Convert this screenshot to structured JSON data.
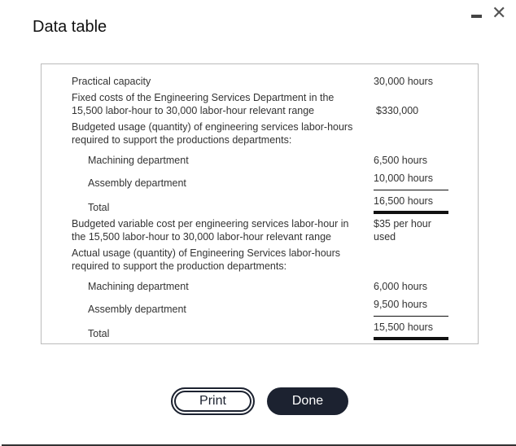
{
  "dialog": {
    "title": "Data table",
    "minimize_icon": "minimize-icon",
    "close_icon": "close-icon",
    "close_glyph": "✕"
  },
  "table": {
    "practical_capacity": {
      "label": "Practical capacity",
      "value": "30,000 hours"
    },
    "fixed_costs": {
      "label_line1": "Fixed costs of the Engineering Services Department in the",
      "label_line2": "15,500 labor-hour to 30,000 labor-hour relevant range",
      "value": "$330,000"
    },
    "budgeted_usage": {
      "label_line1": "Budgeted usage (quantity) of engineering services labor-hours",
      "label_line2": "required to support the productions departments:",
      "machining": {
        "label": "Machining department",
        "value": "6,500 hours"
      },
      "assembly": {
        "label": "Assembly department",
        "value": "10,000 hours"
      },
      "total": {
        "label": "Total",
        "value": "16,500 hours"
      }
    },
    "variable_cost": {
      "label_line1": "Budgeted variable cost per engineering services labor-hour in",
      "label_line2": "the 15,500 labor-hour to 30,000 labor-hour relevant range",
      "value_line1": "$35 per hour",
      "value_line2": "used"
    },
    "actual_usage": {
      "label_line1": "Actual usage (quantity) of Engineering Services labor-hours",
      "label_line2": "required to support the production departments:",
      "machining": {
        "label": "Machining department",
        "value": "6,000 hours"
      },
      "assembly": {
        "label": "Assembly department",
        "value": "9,500 hours"
      },
      "total": {
        "label": "Total",
        "value": "15,500 hours"
      }
    }
  },
  "buttons": {
    "print": "Print",
    "done": "Done"
  }
}
